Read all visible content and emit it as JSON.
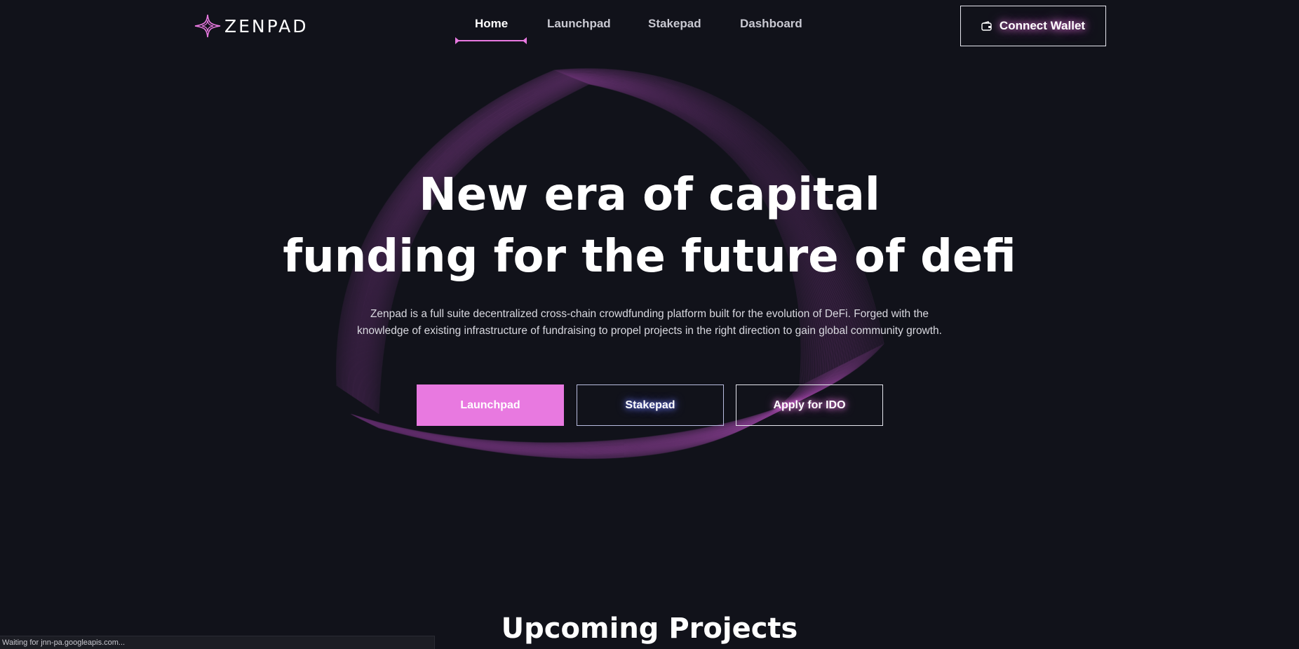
{
  "brand": {
    "name": "ZENPAD",
    "accent_color": "#e879e0",
    "background_color": "#11121a"
  },
  "nav": {
    "items": [
      {
        "label": "Home",
        "active": true
      },
      {
        "label": "Launchpad",
        "active": false
      },
      {
        "label": "Stakepad",
        "active": false
      },
      {
        "label": "Dashboard",
        "active": false
      }
    ]
  },
  "header": {
    "connect_wallet_label": "Connect Wallet",
    "connect_wallet_icon": "wallet-icon"
  },
  "hero": {
    "title_line1": "New era of capital",
    "title_line2": "funding for the future of defi",
    "description": "Zenpad is a full suite decentralized cross-chain crowdfunding platform built for the evolution of DeFi. Forged with the knowledge of existing infrastructure of fundraising to propel projects in the right direction to gain global community growth.",
    "buttons": {
      "launchpad": "Launchpad",
      "stakepad": "Stakepad",
      "apply": "Apply for IDO"
    }
  },
  "sections": {
    "upcoming_title": "Upcoming Projects"
  },
  "status_bar": {
    "text": "Waiting for jnn-pa.googleapis.com..."
  }
}
